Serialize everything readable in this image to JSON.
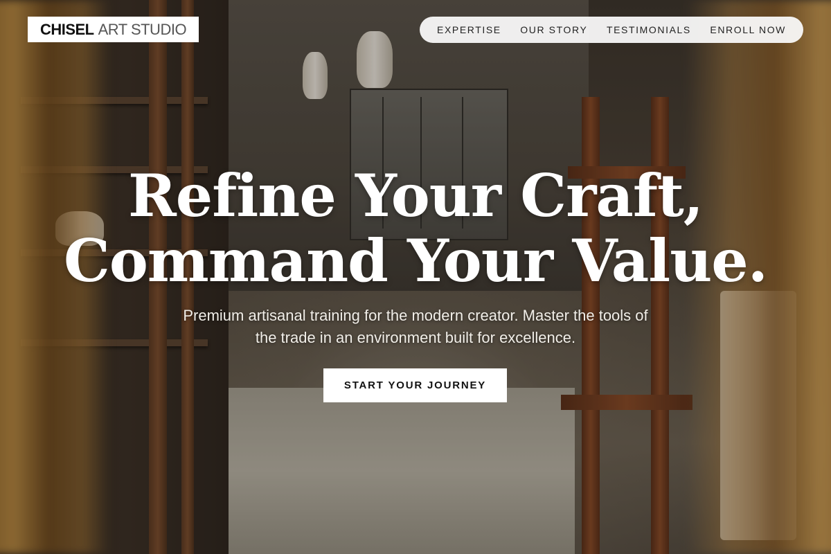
{
  "brand": {
    "name_bold": "CHISEL",
    "name_light": "ART STUDIO"
  },
  "nav": {
    "items": [
      {
        "label": "EXPERTISE"
      },
      {
        "label": "OUR STORY"
      },
      {
        "label": "TESTIMONIALS"
      },
      {
        "label": "ENROLL NOW"
      }
    ]
  },
  "hero": {
    "headline_line1": "Refine Your Craft,",
    "headline_line2": "Command Your Value.",
    "subheadline": "Premium artisanal training for the modern creator. Master the tools of the trade in an environment built for excellence.",
    "cta_label": "START YOUR JOURNEY",
    "background": "Dimly lit artisan workshop with pottery shelves, wooden easel and golden curtains"
  },
  "colors": {
    "text_light": "#ffffff",
    "nav_bg": "#fafafa",
    "logo_bg": "#ffffff",
    "cta_bg": "#ffffff",
    "cta_text": "#111111"
  }
}
